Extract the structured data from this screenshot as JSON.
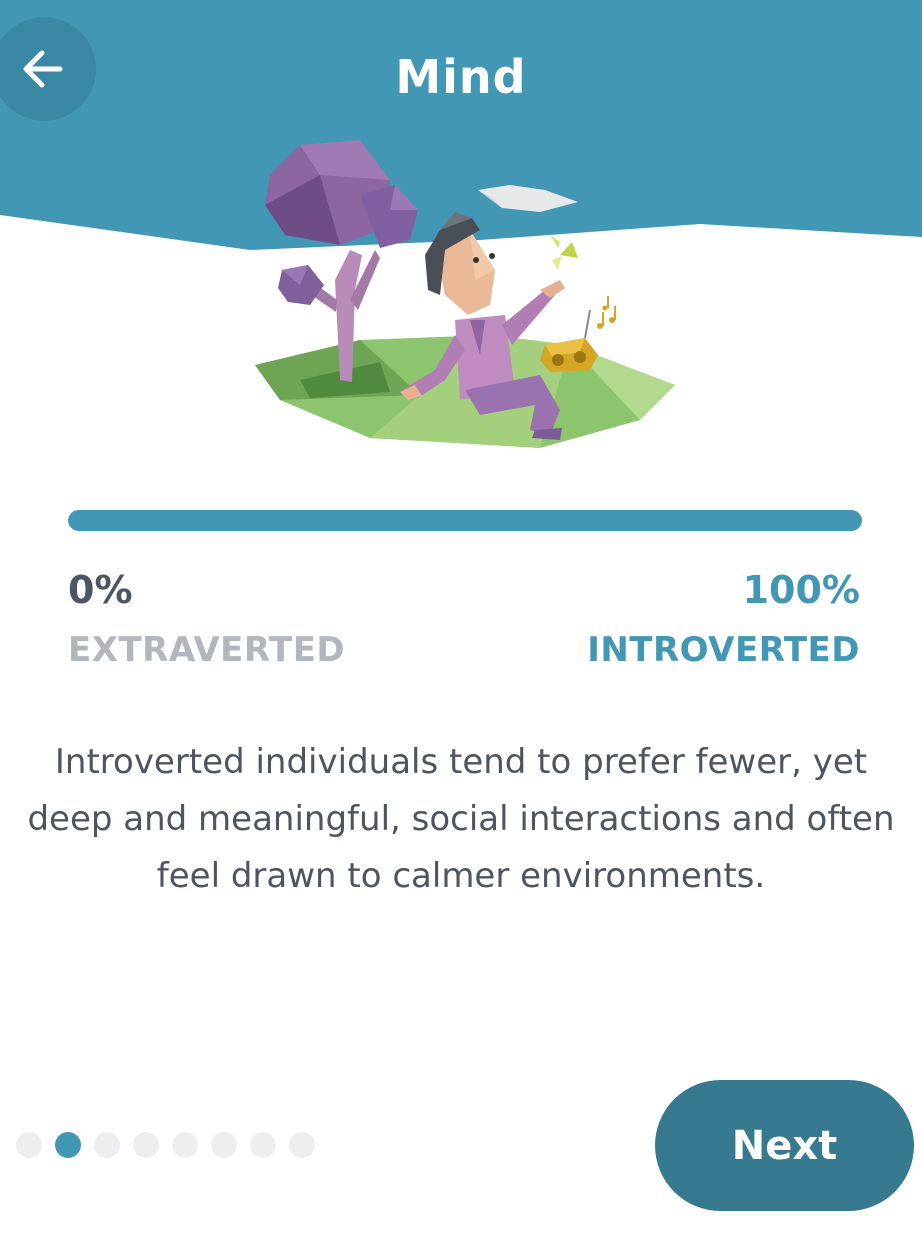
{
  "header": {
    "title": "Mind",
    "back_icon": "arrow-left-icon",
    "color": "#4298b4"
  },
  "illustration": {
    "icons": [
      "tree-icon",
      "person-icon",
      "butterfly-icon",
      "cloud-icon",
      "radio-icon",
      "music-notes-icon"
    ]
  },
  "progress": {
    "value_percent": 100,
    "left_percent_label": "0%",
    "right_percent_label": "100%",
    "left_trait": "EXTRAVERTED",
    "right_trait": "INTROVERTED",
    "accent_color": "#4298b4"
  },
  "description": "Introverted individuals tend to prefer fewer, yet deep and meaningful, social interactions and often feel drawn to calmer environments.",
  "pagination": {
    "total": 8,
    "active_index": 1
  },
  "next_button": {
    "label": "Next",
    "color": "#37798f"
  }
}
